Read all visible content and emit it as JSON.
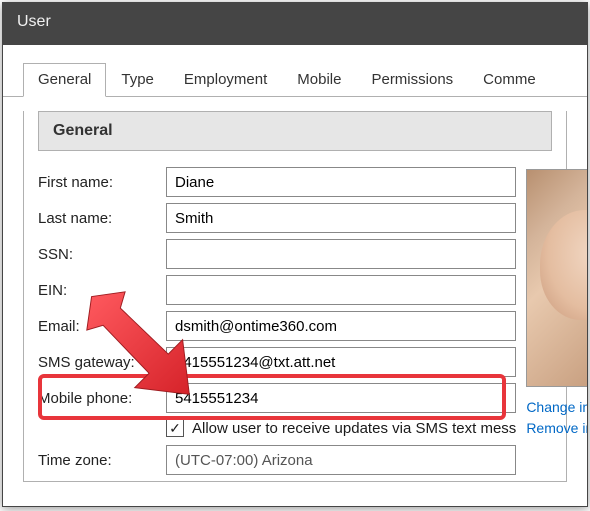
{
  "window": {
    "title": "User"
  },
  "tabs": {
    "general": "General",
    "type": "Type",
    "employment": "Employment",
    "mobile": "Mobile",
    "permissions": "Permissions",
    "comments": "Comme"
  },
  "section": {
    "header": "General"
  },
  "form": {
    "first_name": {
      "label": "First name:",
      "value": "Diane"
    },
    "last_name": {
      "label": "Last name:",
      "value": "Smith"
    },
    "ssn": {
      "label": "SSN:",
      "value": ""
    },
    "ein": {
      "label": "EIN:",
      "value": ""
    },
    "email": {
      "label": "Email:",
      "value": "dsmith@ontime360.com"
    },
    "sms": {
      "label": "SMS gateway:",
      "value": "5415551234@txt.att.net"
    },
    "mobile": {
      "label": "Mobile phone:",
      "value": "5415551234"
    },
    "allow_sms": {
      "label": "Allow user to receive updates via SMS text mess",
      "checked": true
    },
    "timezone": {
      "label": "Time zone:",
      "value": "(UTC-07:00) Arizona"
    }
  },
  "photo": {
    "change": "Change im",
    "remove": "Remove im"
  }
}
